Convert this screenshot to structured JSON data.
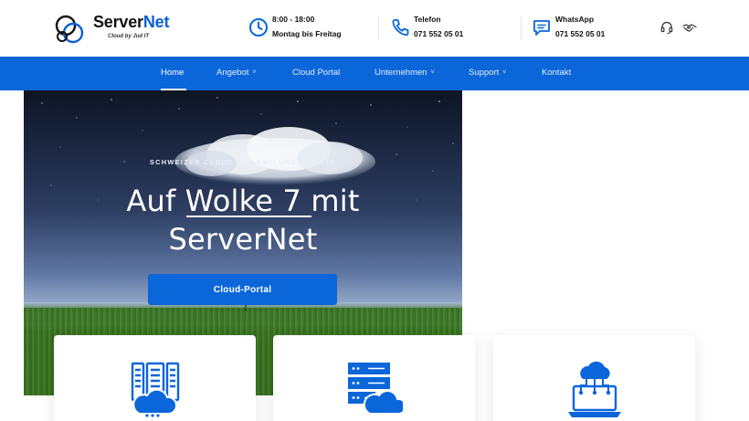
{
  "brand": {
    "name_part1": "Server",
    "name_part2": "Net",
    "tagline": "Cloud by Jud IT",
    "accent_color": "#0a66d9"
  },
  "header": {
    "hours": {
      "icon": "clock-icon",
      "line1": "8:00 - 18:00",
      "line2": "Montag bis Freitag"
    },
    "phone": {
      "icon": "phone-icon",
      "line1": "Telefon",
      "line2": "071 552 05 01"
    },
    "whatsapp": {
      "icon": "chat-icon",
      "line1": "WhatsApp",
      "line2": "071 552 05 01"
    },
    "utility_icons": [
      "support-headset-icon",
      "handshake-icon"
    ]
  },
  "nav": {
    "items": [
      {
        "label": "Home",
        "active": true,
        "has_dropdown": false
      },
      {
        "label": "Angebot",
        "active": false,
        "has_dropdown": true
      },
      {
        "label": "Cloud Portal",
        "active": false,
        "has_dropdown": false
      },
      {
        "label": "Unternehmen",
        "active": false,
        "has_dropdown": true
      },
      {
        "label": "Support",
        "active": false,
        "has_dropdown": true
      },
      {
        "label": "Kontakt",
        "active": false,
        "has_dropdown": false
      }
    ],
    "chevron": "˅"
  },
  "hero": {
    "kicker": "SCHWEIZER CLOUD FÜR KMU UND PRIVATE",
    "title_line1": "Auf Wolke 7 mit",
    "title_line2": "ServerNet",
    "button_label": "Cloud-Portal"
  },
  "cards": [
    {
      "icon": "server-cloud-icon"
    },
    {
      "icon": "server-rack-cloud-icon"
    },
    {
      "icon": "cloud-network-laptop-icon"
    }
  ]
}
